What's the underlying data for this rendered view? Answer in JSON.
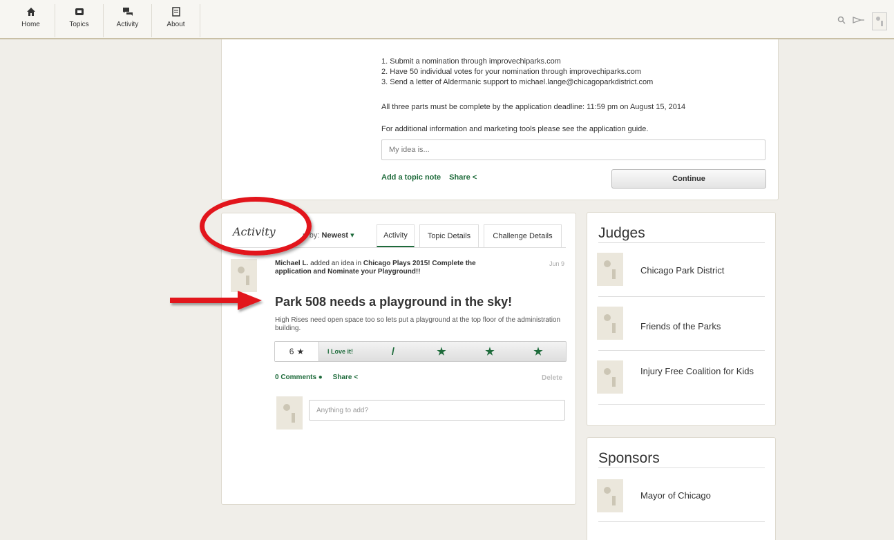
{
  "nav": {
    "items": [
      {
        "label": "Home",
        "icon": "home-icon"
      },
      {
        "label": "Topics",
        "icon": "topics-icon"
      },
      {
        "label": "Activity",
        "icon": "activity-icon"
      },
      {
        "label": "About",
        "icon": "about-icon"
      }
    ],
    "right_icons": [
      "search-icon",
      "megaphone-icon",
      "user-avatar-icon"
    ]
  },
  "topic": {
    "steps": [
      "1. Submit a nomination through improvechiparks.com",
      "2. Have 50 individual votes for your nomination through improvechiparks.com",
      "3. Send a letter of Aldermanic support to michael.lange@chicagoparkdistrict.com"
    ],
    "deadline_text": "All three parts must be complete by the application deadline: 11:59 pm on August 15, 2014",
    "info_text": "For additional information and marketing tools please see the application guide.",
    "idea_placeholder": "My idea is...",
    "add_note_label": "Add a topic note",
    "share_label": "Share",
    "continue_label": "Continue"
  },
  "activity": {
    "title": "Activity",
    "sort_label": "rt by:",
    "sort_value": "Newest",
    "tabs": [
      "Activity",
      "Topic Details",
      "Challenge Details"
    ],
    "item": {
      "author": "Michael L.",
      "action": "added an idea in",
      "challenge": "Chicago Plays 2015! Complete the application and Nominate your Playground!!",
      "date": "Jun 9",
      "idea_title": "Park 508 needs a playground in the sky!",
      "description": "High Rises need open space too so lets put a playground at the top floor of the administration building.",
      "vote_count": "6",
      "vote_label": "I Love it!",
      "comments_label": "0 Comments",
      "share_label": "Share",
      "delete_label": "Delete",
      "comment_placeholder": "Anything to add?"
    }
  },
  "judges": {
    "title": "Judges",
    "items": [
      "Chicago Park District",
      "Friends of the Parks",
      "Injury Free Coalition for Kids"
    ]
  },
  "sponsors": {
    "title": "Sponsors",
    "items": [
      "Mayor of Chicago"
    ]
  },
  "annotation_color": "#e2151c",
  "accent_color": "#1e6b3b"
}
